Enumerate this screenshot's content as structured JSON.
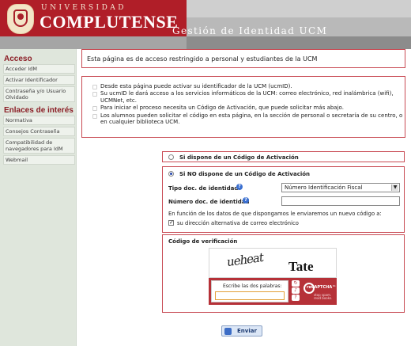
{
  "header": {
    "logo_universidad": "UNIVERSIDAD",
    "logo_complutense": "COMPLUTENSE",
    "page_title": "Gestión de Identidad UCM"
  },
  "sidebar": {
    "section_acceso": "Acceso",
    "acceso_items": [
      {
        "label": "Acceder IdM"
      },
      {
        "label": "Activar Identificador"
      },
      {
        "label": "Contraseña y/o Usuario Olvidado"
      }
    ],
    "section_enlaces": "Enlaces de interés",
    "enlaces_items": [
      {
        "label": "Normativa"
      },
      {
        "label": "Consejos Contraseña"
      },
      {
        "label": "Compatibilidad de navegadores para IdM"
      },
      {
        "label": "Webmail"
      }
    ]
  },
  "notice": "Esta página es de acceso restringido a personal y estudiantes de la UCM",
  "info": {
    "b1": "Desde esta página puede activar su identificador de la UCM (ucmID).",
    "b2": "Su ucmID le dará acceso a los servicios informáticos de la UCM: correo electrónico, red inalámbrica (wifi), UCMNet, etc.",
    "b3": "Para iniciar el proceso necesita un Código de Activación, que puede solicitar más abajo.",
    "b4": "Los alumnos pueden solicitar el código en esta página, en la sección de personal o secretaría de su centro, o en cualquier biblioteca UCM."
  },
  "form": {
    "option_si": "Si dispone de un Código de Activación",
    "option_no": "Si NO dispone de un Código de Activación",
    "tipo_doc_label": "Tipo doc. de identidad",
    "tipo_doc_value": "Número Identificación Fiscal",
    "numero_doc_label": "Número doc. de identidad",
    "numero_doc_value": "",
    "envio_text": "En función de los datos de que dispongamos le enviaremos un nuevo código a:",
    "alt_email_label": "su dirección alternativa de correo electrónico",
    "alt_email_checked": true,
    "verificacion_title": "Código de verificación",
    "captcha_word1": "ueheat",
    "captcha_word2": "Tate",
    "captcha_prompt": "Escribe las dos palabras:",
    "captcha_answer": "",
    "recaptcha_brand": "reCAPTCHA™",
    "recaptcha_tagline": "stop spam. read books.",
    "submit_label": "Enviar"
  },
  "colors": {
    "brand_red": "#b01e28",
    "box_border": "#c84a53",
    "sidebar_bg": "#dfe6dc"
  }
}
